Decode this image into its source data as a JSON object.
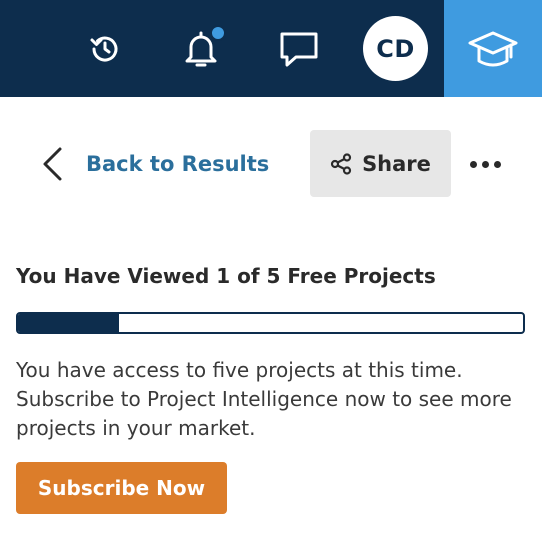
{
  "header": {
    "icons": [
      "history-icon",
      "bell-icon",
      "chat-icon",
      "graduation-cap-icon"
    ],
    "avatar_initials": "CD",
    "notification_dot_color": "#3f9be0",
    "background": "#0d2d4d",
    "academy_background": "#3f9be0"
  },
  "nav": {
    "back_label": "Back to Results",
    "share_label": "Share",
    "more_icon": "more-horizontal-icon"
  },
  "paywall": {
    "title": "You Have Viewed 1 of 5 Free Projects",
    "progress_fraction": 0.2,
    "description": "You have access to five projects at this time. Subscribe to Project Intelligence now to see more projects in your market.",
    "cta_label": "Subscribe Now",
    "cta_color": "#dc7d2a"
  }
}
